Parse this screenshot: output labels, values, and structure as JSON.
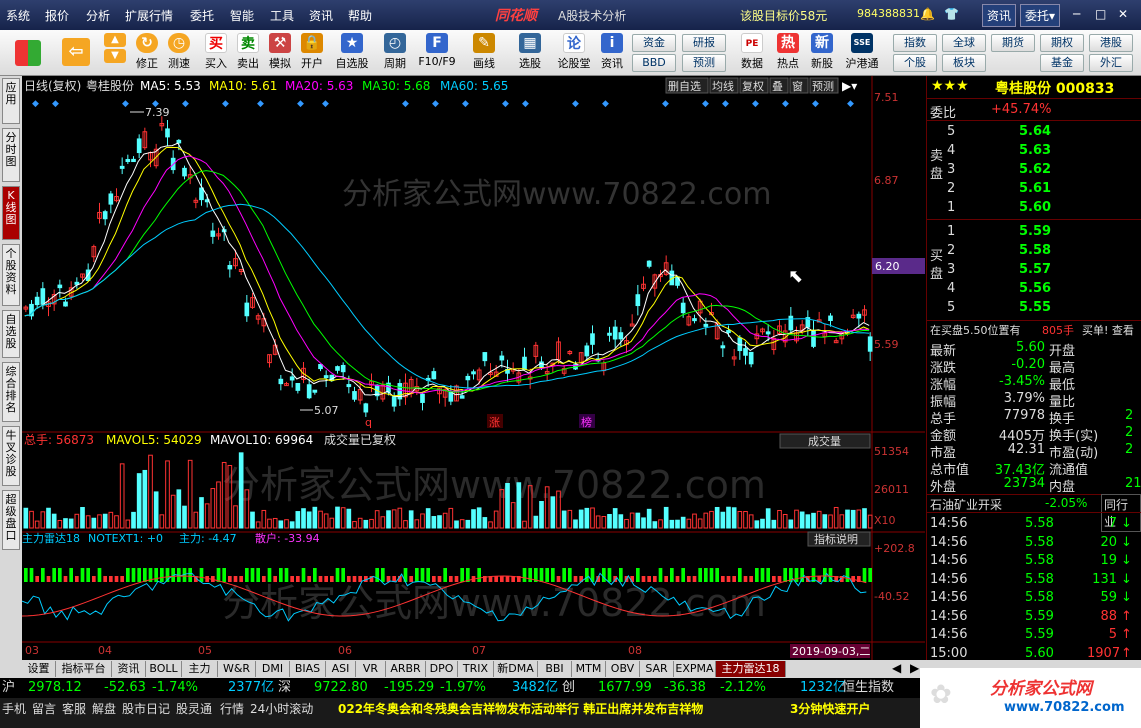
{
  "menu": {
    "items": [
      "系统",
      "报价",
      "分析",
      "扩展行情",
      "委托",
      "智能",
      "工具",
      "资讯",
      "帮助"
    ],
    "logo": "同花顺",
    "app": "A股技术分析",
    "target": "该股目标价58元",
    "account": "984388831",
    "zixun": "资讯",
    "weituo": "委托"
  },
  "toolbar": {
    "items": [
      "",
      "修正",
      "测速",
      "买入",
      "卖出",
      "模拟",
      "开户",
      "自选股",
      "周期",
      "F10/F9",
      "画线",
      "选股",
      "论股堂",
      "资讯",
      "数据",
      "热点",
      "新股",
      "沪港通"
    ],
    "icons": [
      "",
      "qiu",
      "",
      "买",
      "卖",
      "锤",
      "锁",
      "星",
      "钟",
      "F",
      "笔",
      "屏",
      "论",
      "讯",
      "PE",
      "热",
      "新",
      "SSE"
    ],
    "btns1": [
      "资金",
      "研报"
    ],
    "btns2": [
      "BBD",
      "预测"
    ],
    "right1": [
      "指数",
      "全球",
      "期货",
      "期权",
      "港股"
    ],
    "right2": [
      "个股",
      "板块",
      "基金",
      "外汇"
    ]
  },
  "lefttabs": [
    "应用",
    "分时图",
    "K线图",
    "个股资料",
    "自选股",
    "综合排名",
    "牛叉诊股",
    "超级盘口"
  ],
  "kline": {
    "header": "日线(复权)",
    "stock": "粤桂股份",
    "ma5": "MA5: 5.53",
    "ma10": "MA10: 5.61",
    "ma20": "MA20: 5.63",
    "ma30": "MA30: 5.68",
    "ma60": "MA60: 5.65",
    "buttons": [
      "删自选",
      "均线",
      "复权",
      "叠",
      "窗",
      "预测"
    ],
    "ylabels": [
      "7.51",
      "6.87",
      "6.20",
      "5.59"
    ],
    "high": "7.39",
    "low": "5.07",
    "watermark": "分析家公式网www.70822.com",
    "markers": [
      "q",
      "涨",
      "榜"
    ],
    "current": "6.20"
  },
  "volume": {
    "total": "总手: 56873",
    "mavol5": "MAVOL5: 54029",
    "mavol10": "MAVOL10: 69964",
    "note": "成交量已复权",
    "select": "成交量",
    "ylabels": [
      "51354",
      "26011",
      "X10"
    ]
  },
  "indicator": {
    "name": "主力雷达18",
    "notext": "NOTEXT1: +0",
    "zhuli": "主力: -4.47",
    "sanhu": "散户: -33.94",
    "explain": "指标说明",
    "ylabels": [
      "+202.8",
      "-40.52"
    ]
  },
  "xaxis": [
    "03",
    "04",
    "05",
    "06",
    "07",
    "08"
  ],
  "date": "2019-09-03,二",
  "quote": {
    "title": "粤桂股份 000833",
    "stars": "★★★",
    "weibi": "委比",
    "weibi_val": "+45.74%",
    "sell": [
      [
        "5",
        "5.64"
      ],
      [
        "4",
        "5.63"
      ],
      [
        "3",
        "5.62"
      ],
      [
        "2",
        "5.61"
      ],
      [
        "1",
        "5.60"
      ]
    ],
    "buy": [
      [
        "1",
        "5.59"
      ],
      [
        "2",
        "5.58"
      ],
      [
        "3",
        "5.57"
      ],
      [
        "4",
        "5.56"
      ],
      [
        "5",
        "5.55"
      ]
    ],
    "sell_label": "卖盘",
    "buy_label": "买盘",
    "tip1": "在买盘5.50位置有",
    "tip2": "805手",
    "tip3": "买单! 查看",
    "stats": [
      [
        "最新",
        "5.60",
        "开盘"
      ],
      [
        "涨跌",
        "-0.20",
        "最高"
      ],
      [
        "涨幅",
        "-3.45%",
        "最低"
      ],
      [
        "振幅",
        "3.79%",
        "量比"
      ],
      [
        "总手",
        "77978",
        "换手"
      ],
      [
        "金额",
        "4405万",
        "换手(实)"
      ],
      [
        "市盈",
        "42.31",
        "市盈(动)"
      ],
      [
        "总市值",
        "37.43亿",
        "流通值"
      ],
      [
        "外盘",
        "23734",
        "内盘"
      ]
    ],
    "stats_right": [
      "2",
      "2",
      "2",
      "",
      "21."
    ],
    "sector": "石油矿业开采",
    "sector_pct": "-2.05%",
    "peer": "同行业",
    "ticks": [
      [
        "14:56",
        "5.58",
        "7"
      ],
      [
        "14:56",
        "5.58",
        "20"
      ],
      [
        "14:56",
        "5.58",
        "19"
      ],
      [
        "14:56",
        "5.58",
        "131"
      ],
      [
        "14:56",
        "5.58",
        "59"
      ],
      [
        "14:56",
        "5.59",
        "88"
      ],
      [
        "14:56",
        "5.59",
        "5"
      ],
      [
        "15:00",
        "5.60",
        "1907"
      ]
    ]
  },
  "bottomtabs": [
    "设置",
    "指标平台",
    "资讯",
    "BOLL",
    "主力",
    "W&R",
    "DMI",
    "BIAS",
    "ASI",
    "VR",
    "ARBR",
    "DPO",
    "TRIX",
    "新DMA",
    "BBI",
    "MTM",
    "OBV",
    "SAR",
    "EXPMA",
    "主力雷达18"
  ],
  "index": {
    "sh": "沪",
    "sh_val": "2978.12",
    "sh_chg": "-52.63",
    "sh_pct": "-1.74%",
    "sh_amt": "2377亿",
    "sz": "深",
    "sz_val": "9722.80",
    "sz_chg": "-195.29",
    "sz_pct": "-1.97%",
    "sz_amt": "3482亿",
    "cy": "创",
    "cy_val": "1677.99",
    "cy_chg": "-36.38",
    "cy_pct": "-2.12%",
    "cy_amt": "1232亿",
    "hs": "恒生指数"
  },
  "status": {
    "items": [
      "手机",
      "留言",
      "客服",
      "解盘",
      "股市日记",
      "股灵通",
      "行情",
      "24小时滚动"
    ],
    "news": "022年冬奥会和冬残奥会吉祥物发布活动举行 韩正出席并发布吉祥物",
    "kaihu": "3分钟快速开户",
    "brand": "分析家公式网",
    "url": "www.70822.com"
  }
}
